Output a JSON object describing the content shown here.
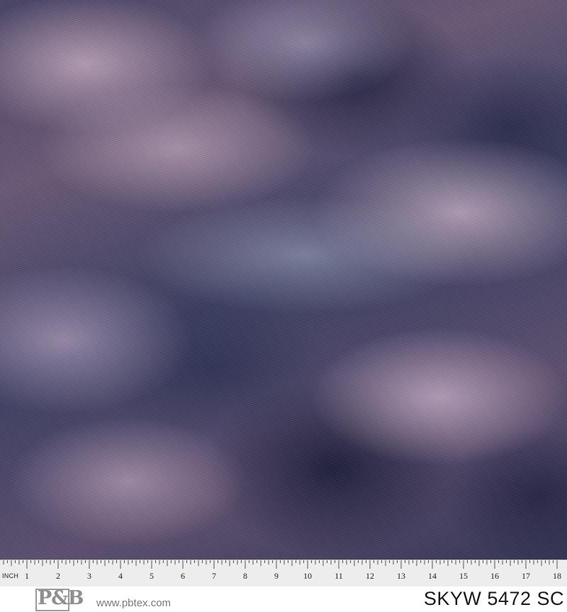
{
  "ruler": {
    "unit_label": "INCH",
    "numbers": [
      "1",
      "2",
      "3",
      "4",
      "5",
      "6",
      "7",
      "8",
      "9",
      "10",
      "11",
      "12",
      "13",
      "14",
      "15",
      "16",
      "17",
      "18"
    ]
  },
  "footer": {
    "logo_text": "P&B",
    "website": "www.pbtex.com",
    "sku": "SKYW 5472 SC"
  },
  "colors": {
    "fabric_dark": "#2a2c50",
    "fabric_mauve": "#c4aabd",
    "fabric_slate": "#5a6080",
    "ruler_bg": "#ededed"
  }
}
